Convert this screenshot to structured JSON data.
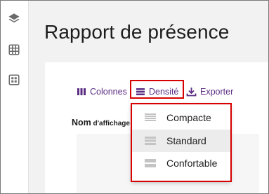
{
  "page": {
    "title": "Rapport de présence"
  },
  "sidebar": {
    "items": [
      {
        "icon": "layers-icon"
      },
      {
        "icon": "grid-icon"
      },
      {
        "icon": "dashboard-icon"
      }
    ]
  },
  "toolbar": {
    "columns_label": "Colonnes",
    "density_label": "Densité",
    "export_label": "Exporter"
  },
  "table": {
    "header_main": "Nom",
    "header_small": " d'affichage"
  },
  "density_menu": {
    "items": [
      {
        "label": "Compacte",
        "selected": false
      },
      {
        "label": "Standard",
        "selected": true
      },
      {
        "label": "Confortable",
        "selected": false
      }
    ]
  },
  "colors": {
    "accent": "#5b2d82",
    "highlight": "#d60000"
  }
}
